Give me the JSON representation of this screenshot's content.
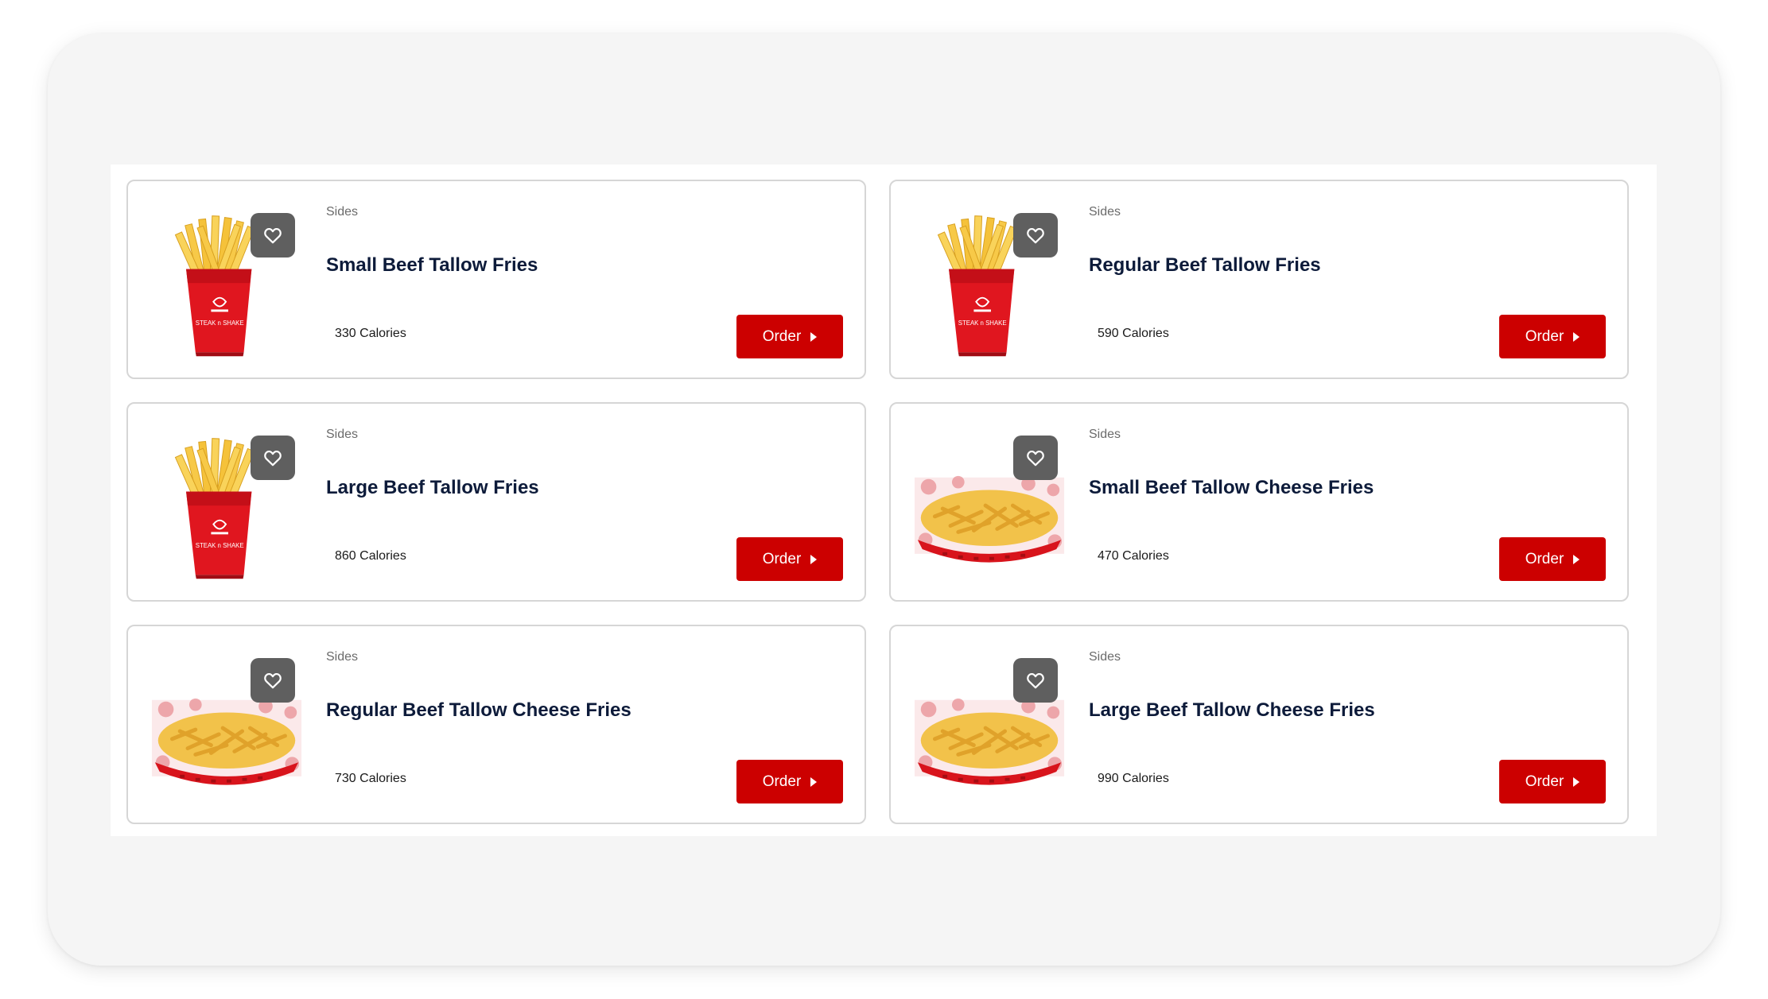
{
  "menu": {
    "items": [
      {
        "category": "Sides",
        "name": "Small Beef Tallow Fries",
        "calories": "330 Calories",
        "order_label": "Order",
        "image": "fries-cup",
        "favorite_icon": "heart-outline-icon"
      },
      {
        "category": "Sides",
        "name": "Regular Beef Tallow Fries",
        "calories": "590 Calories",
        "order_label": "Order",
        "image": "fries-cup",
        "favorite_icon": "heart-outline-icon"
      },
      {
        "category": "Sides",
        "name": "Large Beef Tallow Fries",
        "calories": "860 Calories",
        "order_label": "Order",
        "image": "fries-cup",
        "favorite_icon": "heart-outline-icon"
      },
      {
        "category": "Sides",
        "name": "Small Beef Tallow Cheese Fries",
        "calories": "470 Calories",
        "order_label": "Order",
        "image": "cheese-fries-basket",
        "favorite_icon": "heart-outline-icon"
      },
      {
        "category": "Sides",
        "name": "Regular Beef Tallow Cheese Fries",
        "calories": "730 Calories",
        "order_label": "Order",
        "image": "cheese-fries-basket",
        "favorite_icon": "heart-outline-icon"
      },
      {
        "category": "Sides",
        "name": "Large Beef Tallow Cheese Fries",
        "calories": "990 Calories",
        "order_label": "Order",
        "image": "cheese-fries-basket",
        "favorite_icon": "heart-outline-icon"
      }
    ]
  },
  "colors": {
    "accent": "#cc0000",
    "title_text": "#0d1b3a",
    "favorite_bg": "#5f5f5f",
    "card_border": "#d6d6d6"
  }
}
